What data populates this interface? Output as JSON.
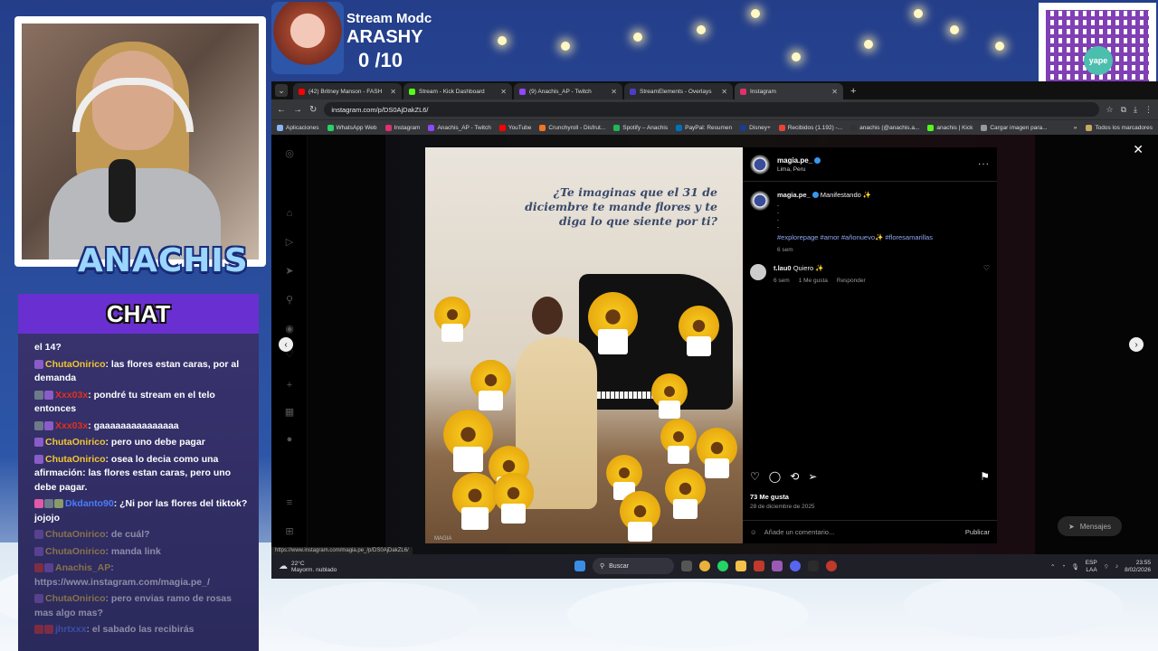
{
  "overlay": {
    "brand": "ANACHIS",
    "stat": {
      "title": "Stream Modc",
      "name": "ARASHY",
      "count": "0 /10"
    },
    "qr_label": "yape"
  },
  "chat": {
    "title": "CHAT",
    "messages": [
      {
        "user": "",
        "user_color": "",
        "text": "el 14?",
        "badges": []
      },
      {
        "user": "ChutaOnirico",
        "user_color": "gold",
        "text": ": las flores estan caras, por al demanda",
        "badges": [
          "#8a5cc7"
        ]
      },
      {
        "user": "Xxx03x",
        "user_color": "red",
        "text": ": pondré tu stream en el telo entonces",
        "badges": [
          "#6c7a8a",
          "#8a5cc7"
        ]
      },
      {
        "user": "Xxx03x",
        "user_color": "red",
        "text": ": gaaaaaaaaaaaaaaa",
        "badges": [
          "#6c7a8a",
          "#8a5cc7"
        ]
      },
      {
        "user": "ChutaOnirico",
        "user_color": "gold",
        "text": ": pero uno debe pagar",
        "badges": [
          "#8a5cc7"
        ]
      },
      {
        "user": "ChutaOnirico",
        "user_color": "gold",
        "text": ": osea lo decia como una afirmación: las flores estan caras, pero uno debe pagar.",
        "badges": [
          "#8a5cc7"
        ]
      },
      {
        "user": "Dkdanto90",
        "user_color": "blue",
        "text": ": ¿Ni por las flores del tiktok? jojojo",
        "badges": [
          "#e05aa8",
          "#6c7a8a",
          "#8a9a6a"
        ]
      },
      {
        "user": "ChutaOnirico",
        "user_color": "gold",
        "text": ": de cuál?",
        "badges": [
          "#8a5cc7"
        ]
      },
      {
        "user": "ChutaOnirico",
        "user_color": "gold",
        "text": ": manda link",
        "badges": [
          "#8a5cc7"
        ]
      },
      {
        "user": "Anachis_AP",
        "user_color": "gold",
        "text": ": https://www.instagram.com/magia.pe_/",
        "badges": [
          "#e0301e",
          "#8a5cc7"
        ]
      },
      {
        "user": "ChutaOnirico",
        "user_color": "gold",
        "text": ": pero envias ramo de rosas mas algo mas?",
        "badges": [
          "#8a5cc7"
        ]
      },
      {
        "user": "jhrtxxx",
        "user_color": "blue",
        "text": ": el sabado las recibirás",
        "badges": [
          "#e0301e",
          "#e03030"
        ]
      }
    ]
  },
  "browser": {
    "tabs": [
      {
        "title": "(42) Britney Manson - FASH",
        "color": "#ff0000",
        "active": false
      },
      {
        "title": "Stream - Kick Dashboard",
        "color": "#53fc18",
        "active": false
      },
      {
        "title": "(9) Anachis_AP - Twitch",
        "color": "#9146ff",
        "active": false
      },
      {
        "title": "StreamElements - Overlays",
        "color": "#4c3dc8",
        "active": false
      },
      {
        "title": "Instagram",
        "color": "#e1306c",
        "active": true
      }
    ],
    "url": "instagram.com/p/DS0AjDakZL6/",
    "bookmarks": [
      {
        "label": "Aplicaciones",
        "color": "#8ab4f8"
      },
      {
        "label": "WhatsApp Web",
        "color": "#25d366"
      },
      {
        "label": "Instagram",
        "color": "#e1306c"
      },
      {
        "label": "Anachis_AP - Twitch",
        "color": "#9146ff"
      },
      {
        "label": "YouTube",
        "color": "#ff0000"
      },
      {
        "label": "Crunchyroll - Disfrut...",
        "color": "#f47521"
      },
      {
        "label": "Spotify – Anachis",
        "color": "#1db954"
      },
      {
        "label": "PayPal: Resumen",
        "color": "#0070ba"
      },
      {
        "label": "Disney+",
        "color": "#1a3c8c"
      },
      {
        "label": "Recibidos (1.192) -...",
        "color": "#ea4335"
      },
      {
        "label": "anachis (@anachis.a...",
        "color": "#333"
      },
      {
        "label": "anachis | Kick",
        "color": "#53fc18"
      },
      {
        "label": "Cargar imagen para...",
        "color": "#999"
      }
    ],
    "bookmarks_more": "»",
    "all_bookmarks": "Todos los marcadores",
    "status_url": "https://www.instagram.com/magia.pe_/p/DS0AjDakZL6/"
  },
  "post": {
    "image_text": "¿Te imaginas que el 31 de diciembre te mande flores y te diga lo que siente por ti?",
    "image_caption": "MAGIA",
    "username": "magia.pe_",
    "location": "Lima, Peru",
    "caption_text": "Manifestando ✨",
    "caption_dots": ".\n.\n.\n.",
    "hashtags": "#explorepage #amor #añonuevo✨ #floresamarillas",
    "caption_time": "6 sem",
    "comment": {
      "user": "t.lau0",
      "text": "Quiero ✨",
      "time": "6 sem",
      "likes": "1 Me gusta",
      "reply": "Responder"
    },
    "likes": "73 Me gusta",
    "date": "28 de diciembre de 2025",
    "add_comment_placeholder": "Añade un comentario...",
    "publish": "Publicar",
    "messages_pill": "Mensajes"
  },
  "taskbar": {
    "weather_temp": "22°C",
    "weather_desc": "Mayorm. nublado",
    "search": "Buscar",
    "lang_top": "ESP",
    "lang_bottom": "LAA",
    "time": "23:55",
    "date": "8/02/2026"
  }
}
